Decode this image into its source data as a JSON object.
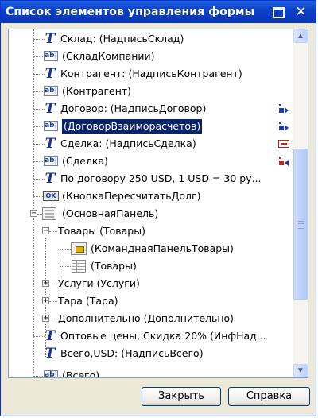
{
  "window": {
    "title": "Список элементов управления формы",
    "maximize_icon": "maximize-icon",
    "close_glyph": "✕"
  },
  "tree": {
    "items": [
      {
        "text": "Склад: (НадписьСклад)",
        "icon": "label-icon"
      },
      {
        "text": "(СкладКомпании)",
        "icon": "text-field-icon"
      },
      {
        "text": "Контрагент: (НадписьКонтрагент)",
        "icon": "label-icon"
      },
      {
        "text": "(Контрагент)",
        "icon": "text-field-icon"
      },
      {
        "text": "Договор: (НадписьДоговор)",
        "icon": "label-icon",
        "marker": "blue-arrow"
      },
      {
        "text": "(ДоговорВзаиморасчетов)",
        "icon": "text-field-icon",
        "marker": "blue-arrow",
        "selected": true
      },
      {
        "text": "Сделка: (НадписьСделка)",
        "icon": "label-icon",
        "marker": "red-box"
      },
      {
        "text": "(Сделка)",
        "icon": "text-field-icon",
        "marker": "red-arrow"
      },
      {
        "text": "По договору 250 USD, 1 USD = 30 ру...",
        "icon": "label-icon"
      },
      {
        "text": "(КнопкаПересчитатьДолг)",
        "icon": "button-icon",
        "icon_text": "OK"
      },
      {
        "text": "(ОсновнаяПанель)",
        "icon": "panel-icon",
        "expander": "−"
      },
      {
        "text": "Товары (Товары)",
        "expander": "−"
      },
      {
        "text": "(КоманднаяПанельТовары)",
        "icon": "command-bar-icon"
      },
      {
        "text": "(Товары)",
        "icon": "table-icon"
      },
      {
        "text": "Услуги (Услуги)",
        "expander": "+"
      },
      {
        "text": "Тара (Тара)",
        "expander": "+"
      },
      {
        "text": "Дополнительно (Дополнительно)",
        "expander": "+"
      },
      {
        "text": "Оптовые цены, Скидка 20% (ИнфНад...",
        "icon": "label-icon"
      },
      {
        "text": "Всего,USD: (НадписьВсего)",
        "icon": "label-icon"
      },
      {
        "text": "(Всего)",
        "icon": "text-field-icon"
      }
    ],
    "label_icon_glyph": "T",
    "text_field_icon_glyph": "ab|",
    "scroll_up": "▲",
    "scroll_down": "▼"
  },
  "buttons": {
    "close_label": "Закрыть",
    "help_label": "Справка"
  },
  "colors": {
    "titlebar": "#0a3fc6",
    "selection": "#0a246a",
    "window_bg": "#ece9d8"
  }
}
